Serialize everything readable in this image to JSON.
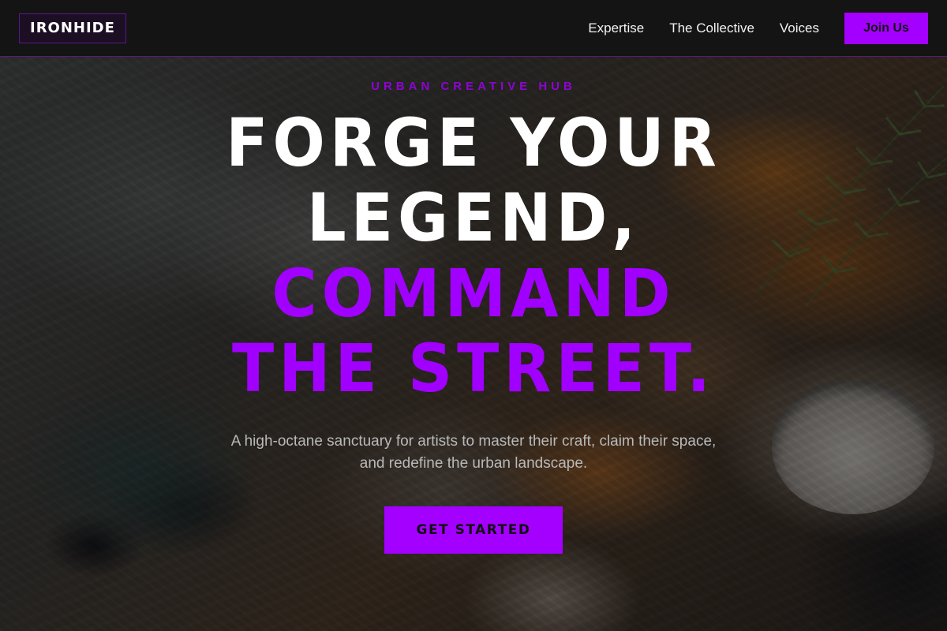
{
  "brand": {
    "logo_text": "IRONHIDE",
    "accent_color": "#a400ff"
  },
  "nav": {
    "links": [
      {
        "label": "Expertise"
      },
      {
        "label": "The Collective"
      },
      {
        "label": "Voices"
      }
    ],
    "cta_label": "Join Us"
  },
  "hero": {
    "eyebrow": "URBAN CREATIVE HUB",
    "headline_lines": [
      "FORGE YOUR",
      "LEGEND,",
      "COMMAND",
      "THE STREET."
    ],
    "subtitle": "A high-octane sanctuary for artists to master their craft, claim their space, and redefine the urban landscape.",
    "cta_label": "GET STARTED",
    "background_image": "textured-paint-palette"
  }
}
